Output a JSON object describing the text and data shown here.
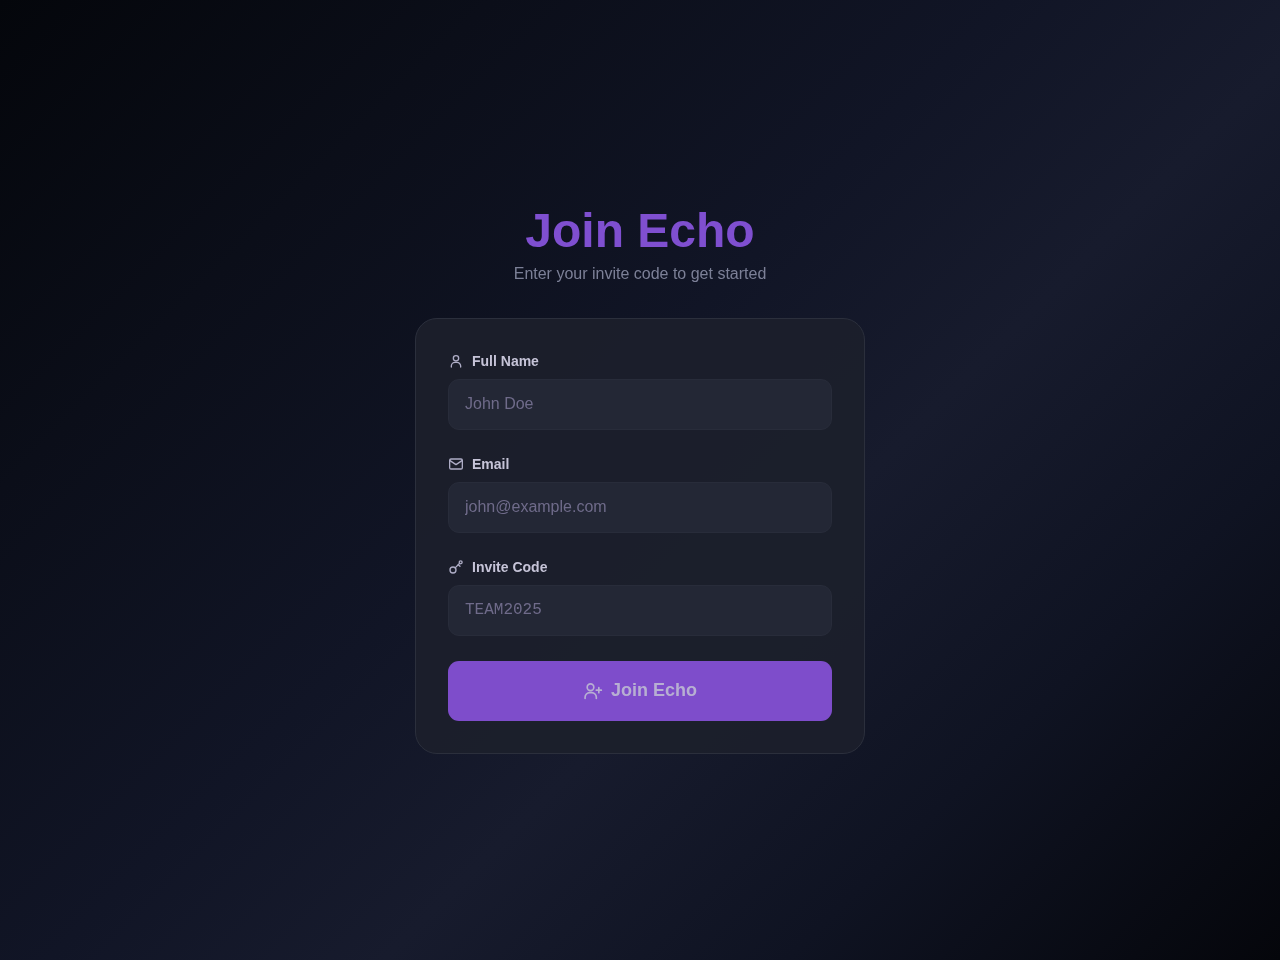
{
  "header": {
    "title": "Join Echo",
    "subtitle": "Enter your invite code to get started"
  },
  "form": {
    "fields": [
      {
        "kind": "name",
        "label": "Full Name",
        "placeholder": "John Doe"
      },
      {
        "kind": "email",
        "label": "Email",
        "placeholder": "john@example.com"
      },
      {
        "kind": "code",
        "label": "Invite Code",
        "placeholder": "TEAM2025"
      }
    ],
    "submit": {
      "label": "Join Echo"
    }
  }
}
